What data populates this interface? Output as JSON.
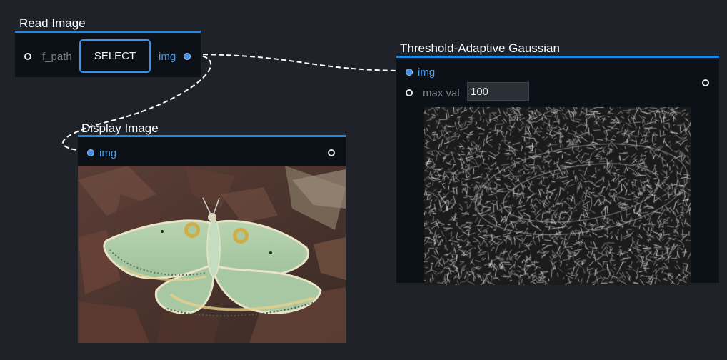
{
  "nodes": {
    "read_image": {
      "title": "Read Image",
      "param_label": "f_path",
      "button_label": "SELECT",
      "output_label": "img"
    },
    "display_image": {
      "title": "Display Image",
      "input_label": "img"
    },
    "threshold": {
      "title": "Threshold-Adaptive Gaussian",
      "input_label": "img",
      "param_label": "max val",
      "param_value": "100"
    }
  },
  "colors": {
    "canvas_bg": "#1f2329",
    "node_bg": "#0c1117",
    "accent": "#1e88e5",
    "port_label": "#4a9be8"
  },
  "images": {
    "display_image": "moth-photo",
    "threshold_output": "moth-threshold-edges"
  }
}
